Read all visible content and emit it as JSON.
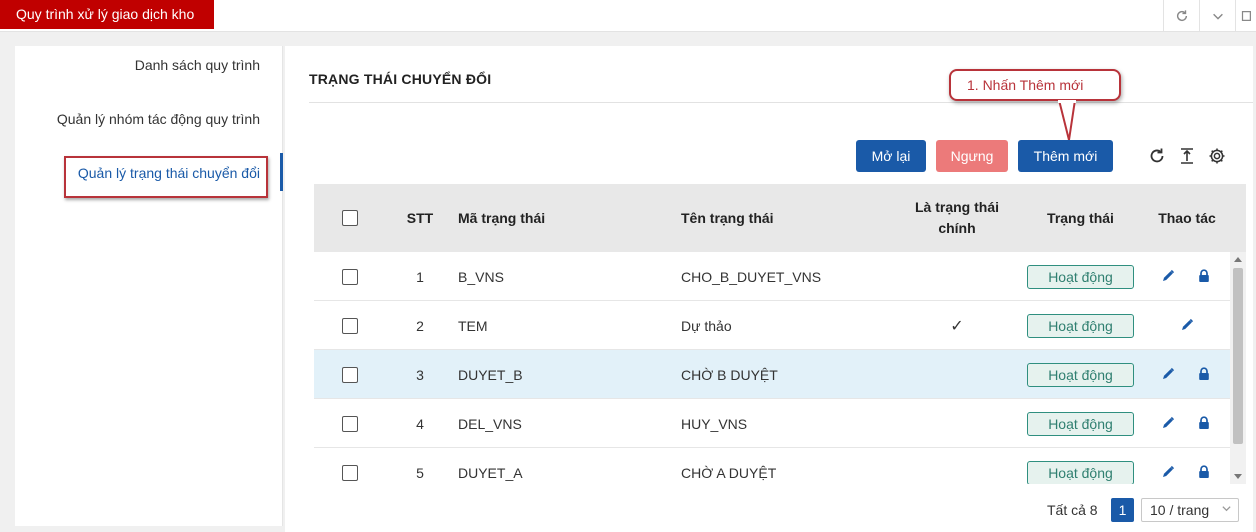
{
  "app": {
    "tab_title": "Quy trình xử lý giao dịch kho"
  },
  "sidebar": {
    "items": [
      {
        "label": "Danh sách quy trình"
      },
      {
        "label": "Quản lý nhóm tác động quy trình"
      },
      {
        "label": "Quản lý trạng thái chuyển đổi"
      }
    ]
  },
  "main": {
    "title": "TRẠNG THÁI CHUYỂN ĐỔI",
    "callout": "1. Nhấn Thêm mới",
    "buttons": {
      "reopen": "Mở lại",
      "stop": "Ngưng",
      "add": "Thêm mới"
    }
  },
  "table": {
    "headers": {
      "stt": "STT",
      "code": "Mã trạng thái",
      "name": "Tên trạng thái",
      "is_main_1": "Là trạng thái",
      "is_main_2": "chính",
      "status": "Trạng thái",
      "actions": "Thao tác"
    },
    "rows": [
      {
        "stt": "1",
        "code": "B_VNS",
        "name": "CHO_B_DUYET_VNS",
        "main": "",
        "status": "Hoạt động"
      },
      {
        "stt": "2",
        "code": "TEM",
        "name": "Dự thảo",
        "main": "✓",
        "status": "Hoạt động"
      },
      {
        "stt": "3",
        "code": "DUYET_B",
        "name": "CHỜ B DUYỆT",
        "main": "",
        "status": "Hoạt động"
      },
      {
        "stt": "4",
        "code": "DEL_VNS",
        "name": "HUY_VNS",
        "main": "",
        "status": "Hoạt động"
      },
      {
        "stt": "5",
        "code": "DUYET_A",
        "name": "CHỜ A DUYỆT",
        "main": "",
        "status": "Hoạt động"
      }
    ]
  },
  "pagination": {
    "total": "Tất cả 8",
    "current_page": "1",
    "page_size": "10 / trang"
  },
  "colors": {
    "brand_red": "#c00000",
    "primary": "#1a5aa8",
    "stop": "#ec7a7a",
    "status_green": "#2f8f7f",
    "selected_row": "#e2f1f9"
  },
  "icons": [
    "refresh-icon",
    "chevron-down-icon",
    "window-icon",
    "reload-icon",
    "column-height-icon",
    "settings-icon",
    "edit-icon",
    "lock-icon"
  ]
}
